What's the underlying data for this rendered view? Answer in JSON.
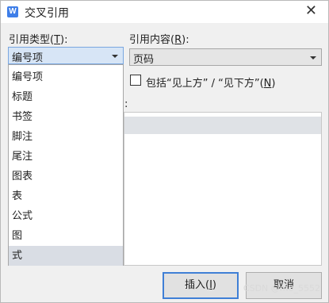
{
  "window": {
    "app_icon": "W",
    "title": "交叉引用",
    "close": "✕"
  },
  "ref_type": {
    "label_pre": "引用类型(",
    "label_key": "T",
    "label_post": "):",
    "selected": "编号项",
    "options": [
      "编号项",
      "标题",
      "书签",
      "脚注",
      "尾注",
      "图表",
      "表",
      "公式",
      "图",
      "式"
    ],
    "highlighted": "式"
  },
  "ref_content": {
    "label_pre": "引用内容(",
    "label_key": "R",
    "label_post": "):",
    "selected": "页码"
  },
  "include": {
    "label_pre": "包括“见上方” / “见下方”(",
    "label_key": "N",
    "label_post": ")",
    "checked": false
  },
  "list_label": ":",
  "buttons": {
    "insert_pre": "插入(",
    "insert_key": "I",
    "insert_post": ")",
    "cancel": "取消"
  },
  "watermark": "CSDN @m0_5552"
}
